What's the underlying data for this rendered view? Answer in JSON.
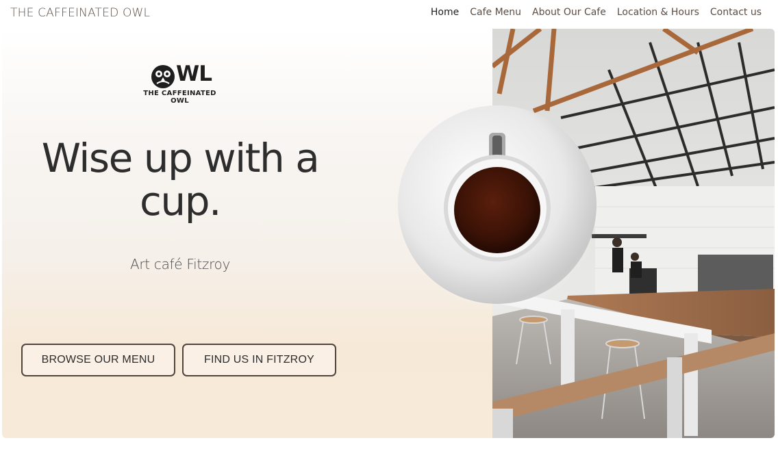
{
  "header": {
    "brand": "THE CAFFEINATED OWL",
    "nav": [
      {
        "label": "Home",
        "active": true
      },
      {
        "label": "Cafe Menu",
        "active": false
      },
      {
        "label": "About Our Cafe",
        "active": false
      },
      {
        "label": "Location & Hours",
        "active": false
      },
      {
        "label": "Contact us",
        "active": false
      }
    ]
  },
  "hero": {
    "logo_word": "WL",
    "logo_subtitle": "THE CAFFEINATED OWL",
    "headline_line1": "Wise up with a",
    "headline_line2": "cup.",
    "subheadline": "Art café Fitzroy",
    "buttons": {
      "browse_menu": "BROWSE OUR MENU",
      "find_us": "FIND US IN FITZROY"
    }
  },
  "colors": {
    "text_dark": "#2d2d2d",
    "brand_brown": "#5a4c42",
    "button_border": "#4f433b",
    "hero_top": "#ffffff",
    "hero_bottom": "#f8ead8"
  },
  "icons": [
    "owl-logo-icon",
    "coffee-cup-image",
    "cafe-interior-photo"
  ]
}
